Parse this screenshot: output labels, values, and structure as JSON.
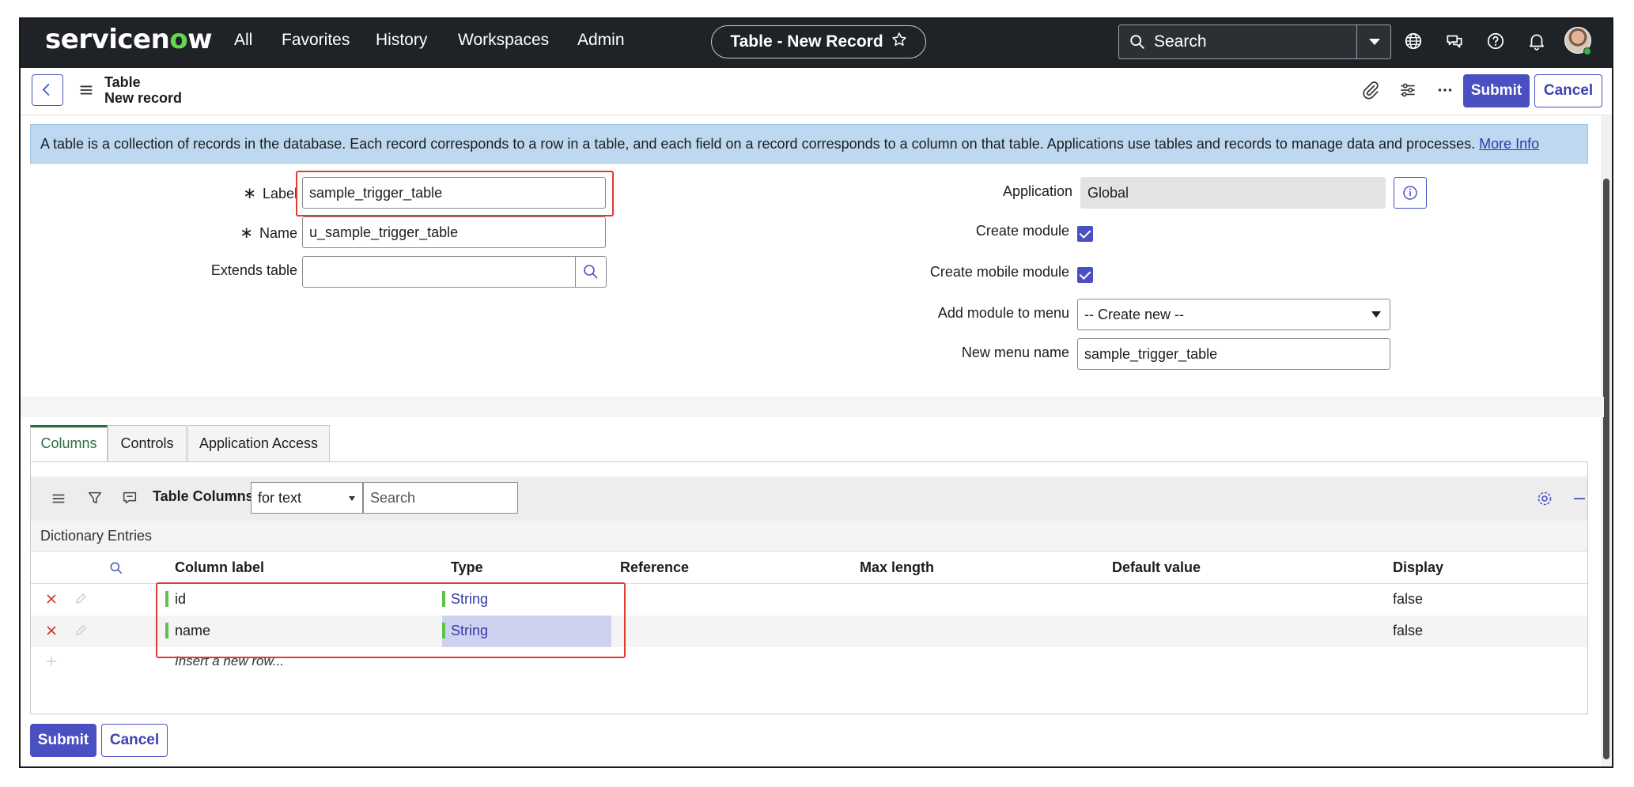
{
  "nav": {
    "logo_pre": "servicen",
    "logo_o": "o",
    "logo_post": "w",
    "items": [
      "All",
      "Favorites",
      "History",
      "Workspaces",
      "Admin"
    ],
    "record_title": "Table - New Record",
    "search_placeholder": "Search"
  },
  "header": {
    "title_line1": "Table",
    "title_line2": "New record",
    "submit": "Submit",
    "cancel": "Cancel"
  },
  "banner": {
    "text": "A table is a collection of records in the database. Each record corresponds to a row in a table, and each field on a record corresponds to a column on that table. Applications use tables and records to manage data and processes.",
    "link": "More Info"
  },
  "form": {
    "label_label": "Label",
    "label_value": "sample_trigger_table",
    "name_label": "Name",
    "name_value": "u_sample_trigger_table",
    "extends_label": "Extends table",
    "extends_value": "",
    "application_label": "Application",
    "application_value": "Global",
    "create_module_label": "Create module",
    "create_mobile_module_label": "Create mobile module",
    "add_module_label": "Add module to menu",
    "add_module_value": "-- Create new --",
    "new_menu_label": "New menu name",
    "new_menu_value": "sample_trigger_table"
  },
  "tabs": [
    "Columns",
    "Controls",
    "Application Access"
  ],
  "list": {
    "title": "Table Columns",
    "filter_select": "for text",
    "search_placeholder": "Search",
    "dictionary_label": "Dictionary Entries",
    "headers": [
      "Column label",
      "Type",
      "Reference",
      "Max length",
      "Default value",
      "Display"
    ],
    "rows": [
      {
        "label": "id",
        "type": "String",
        "reference": "",
        "max_length": "",
        "default": "",
        "display": "false"
      },
      {
        "label": "name",
        "type": "String",
        "reference": "",
        "max_length": "",
        "default": "",
        "display": "false"
      }
    ],
    "insert_text": "Insert a new row..."
  },
  "footer": {
    "submit": "Submit",
    "cancel": "Cancel"
  },
  "colors": {
    "nav_bg": "#1f2226",
    "brand_green": "#62d84e",
    "primary": "#4a4fc1",
    "banner_bg": "#bdd8f0",
    "highlight_red": "#e03b2e"
  }
}
